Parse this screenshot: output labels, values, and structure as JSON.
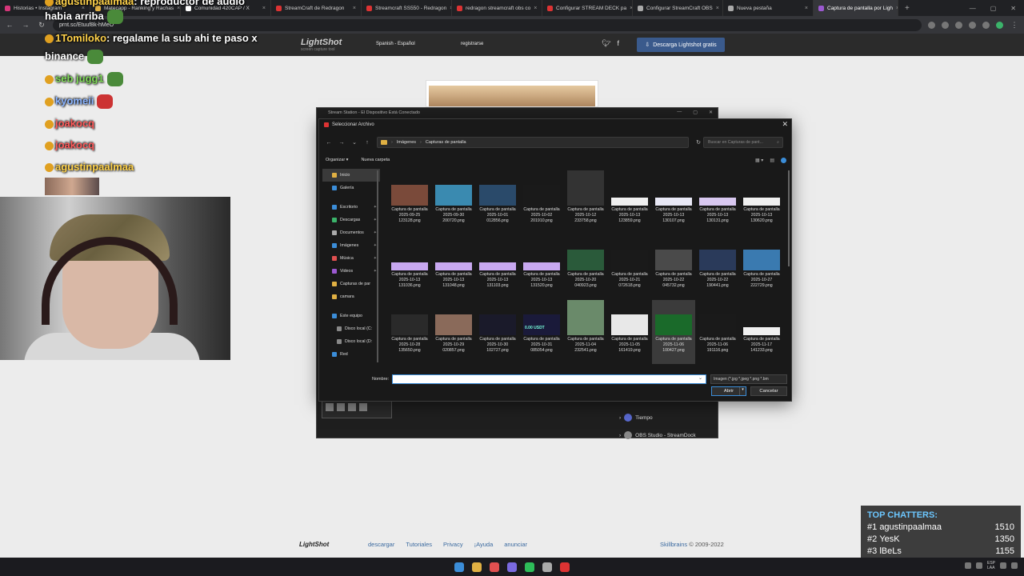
{
  "browser": {
    "tabs": [
      {
        "label": "Historias • Instagram",
        "color": "#d6367a"
      },
      {
        "label": "Matecapp - Ranking y Rachas",
        "color": "#e0b043"
      },
      {
        "label": "Comunidad 420CAP / X",
        "color": "#ffffff"
      },
      {
        "label": "StreamCraft de Redragon",
        "color": "#d33"
      },
      {
        "label": "Streamcraft SS550 - Redragon",
        "color": "#d33"
      },
      {
        "label": "redragon streamcraft obs co",
        "color": "#d33"
      },
      {
        "label": "Configurar STREAM DECK pa",
        "color": "#d33"
      },
      {
        "label": "Configurar StreamCraft OBS",
        "color": "#aaaaaa"
      },
      {
        "label": "Nueva pestaña",
        "color": "#aaaaaa"
      },
      {
        "label": "Captura de pantalla por Ligh",
        "color": "#9b59d0"
      }
    ],
    "url": "prnt.sc/Etuuf8k-hMeO",
    "new_tab": "+"
  },
  "lightshot": {
    "logo": "LightShot",
    "logo_sub": "screen capture tool",
    "language": "Spanish - Español",
    "register": "registrarse",
    "download": "Descarga Lightshot gratis",
    "footer_logo": "LightShot",
    "footer_links": [
      "descargar",
      "Tutoriales",
      "Privacy",
      "¡Ayuda",
      "anunciar"
    ],
    "copyright_brand": "Skillbrains",
    "copyright_rest": "© 2009-2022"
  },
  "chat": [
    {
      "user": "agustinpaalmaa",
      "text": ": reproductor de audio",
      "color": "#ffd24a"
    },
    {
      "user": "",
      "text": "habia arriba",
      "color": "#ffffff"
    },
    {
      "user": "1Tomiloko",
      "text": ": regalame la sub ahi te paso x",
      "color": "#ffd24a"
    },
    {
      "user": "",
      "text": "binance",
      "color": "#ffffff"
    },
    {
      "user": "seb jugg1",
      "text": "",
      "color": "#7ed957"
    },
    {
      "user": "kyomeii",
      "text": "",
      "color": "#8ab4ff"
    },
    {
      "user": "joakocq",
      "text": "",
      "color": "#ff5a5a"
    },
    {
      "user": "joakocq",
      "text": "",
      "color": "#ff5a5a"
    },
    {
      "user": "agustinpaalmaa",
      "text": "",
      "color": "#ffd24a"
    }
  ],
  "stream_app": {
    "title": "Stream Station - El Dispositivo Está Conectado",
    "item1": "Tiempo",
    "item2": "OBS Studio - StreamDock"
  },
  "dialog": {
    "title": "Seleccionar Archivo",
    "breadcrumb": [
      "Imágenes",
      "Capturas de pantalla"
    ],
    "search_placeholder": "Buscar en Capturas de pant...",
    "organize": "Organizar",
    "new_folder": "Nueva carpeta",
    "nav": [
      {
        "label": "Inicio",
        "color": "#e0b043",
        "pin": false,
        "sel": true
      },
      {
        "label": "Galería",
        "color": "#3b8dd8",
        "pin": false
      },
      {
        "label": "",
        "gap": true
      },
      {
        "label": "Escritorio",
        "color": "#3b8dd8",
        "pin": true
      },
      {
        "label": "Descargas",
        "color": "#3bb36a",
        "pin": true
      },
      {
        "label": "Documentos",
        "color": "#aaaaaa",
        "pin": true
      },
      {
        "label": "Imágenes",
        "color": "#3b8dd8",
        "pin": true
      },
      {
        "label": "Música",
        "color": "#e05050",
        "pin": true
      },
      {
        "label": "Videos",
        "color": "#9b59d0",
        "pin": true
      },
      {
        "label": "Capturas de par",
        "color": "#e0b043",
        "pin": false
      },
      {
        "label": "camara",
        "color": "#e0b043",
        "pin": false
      },
      {
        "label": "",
        "gap": true
      },
      {
        "label": "Este equipo",
        "color": "#3b8dd8",
        "pin": false
      },
      {
        "label": "Disco local (C:",
        "color": "#888888",
        "pin": false,
        "sub": true
      },
      {
        "label": "Disco local (D:",
        "color": "#888888",
        "pin": false,
        "sub": true
      },
      {
        "label": "Red",
        "color": "#3b8dd8",
        "pin": false
      }
    ],
    "files": [
      {
        "name": "2025-09-25 123128.png",
        "color": "#7a4a3a"
      },
      {
        "name": "2025-09-30 200720.png",
        "color": "#3a8ab0"
      },
      {
        "name": "2025-10-01 012856.png",
        "color": "#2a4a6a"
      },
      {
        "name": "2025-10-02 201910.png",
        "color": "#1a1a1a"
      },
      {
        "name": "2025-10-12 233758.png",
        "color": "#333333"
      },
      {
        "name": "2025-10-13 123859.png",
        "color": "#f0f0f0"
      },
      {
        "name": "2025-10-13 130107.png",
        "color": "#e8e8f5"
      },
      {
        "name": "2025-10-13 130131.png",
        "color": "#d8c8f0"
      },
      {
        "name": "2025-10-13 130620.png",
        "color": "#f0f0f0"
      },
      {
        "name": "2025-10-13 131036.png",
        "color": "#c8a8f0"
      },
      {
        "name": "2025-10-13 131048.png",
        "color": "#c8a8f0"
      },
      {
        "name": "2025-10-13 131103.png",
        "color": "#c8a8f0"
      },
      {
        "name": "2025-10-13 131520.png",
        "color": "#c8a8f0"
      },
      {
        "name": "2025-10-20 040923.png",
        "color": "#2a5a3a"
      },
      {
        "name": "2025-10-21 072618.png",
        "color": "#1a1a1a"
      },
      {
        "name": "2025-10-22 045732.png",
        "color": "#4a4a4a"
      },
      {
        "name": "2025-10-22 190441.png",
        "color": "#2a3a5a"
      },
      {
        "name": "2025-10-27 222729.png",
        "color": "#3a7ab0"
      },
      {
        "name": "2025-10-28 135650.png",
        "color": "#2a2a2a"
      },
      {
        "name": "2025-10-29 020857.png",
        "color": "#8a6a5a"
      },
      {
        "name": "2025-10-30 102727.png",
        "color": "#1a1a2a"
      },
      {
        "name": "2025-10-31 085054.png",
        "color": "#1a1a3a"
      },
      {
        "name": "2025-11-04 232541.png",
        "color": "#6a8a6a"
      },
      {
        "name": "2025-11-05 161419.png",
        "color": "#e8e8e8"
      },
      {
        "name": "2025-11-06 100427.png",
        "color": "#1a6a2a"
      },
      {
        "name": "2025-11-06 191116.png",
        "color": "#1a1a1a"
      },
      {
        "name": "2025-11-17 141233.png",
        "color": "#f0f0f0"
      }
    ],
    "file_caption": "Captura de pantalla",
    "special_text": "0.00 USDT",
    "filename_label": "Nombre:",
    "filename_value": "",
    "filetype": "Imagen (*.jpg *.jpeg *.png *.bm",
    "open": "Abrir",
    "cancel": "Cancelar"
  },
  "top_chatters": {
    "title": "TOP CHATTERS:",
    "rows": [
      {
        "rank": "#1",
        "name": "agustinpaalmaa",
        "count": "1510"
      },
      {
        "rank": "#2",
        "name": "YesK",
        "count": "1350"
      },
      {
        "rank": "#3",
        "name": "lBeLs",
        "count": "1155"
      }
    ]
  },
  "taskbar": {
    "icons": [
      {
        "name": "windows-start-icon",
        "color": "#3b8dd8"
      },
      {
        "name": "file-explorer-icon",
        "color": "#e0b043"
      },
      {
        "name": "chrome-icon",
        "color": "#e05050"
      },
      {
        "name": "discord-icon",
        "color": "#7a6ae0"
      },
      {
        "name": "spotify-icon",
        "color": "#2ebd59"
      },
      {
        "name": "obs-icon",
        "color": "#aaaaaa"
      },
      {
        "name": "redragon-app-icon",
        "color": "#d33"
      }
    ],
    "lang": "ESP",
    "lang2": "LAA"
  }
}
